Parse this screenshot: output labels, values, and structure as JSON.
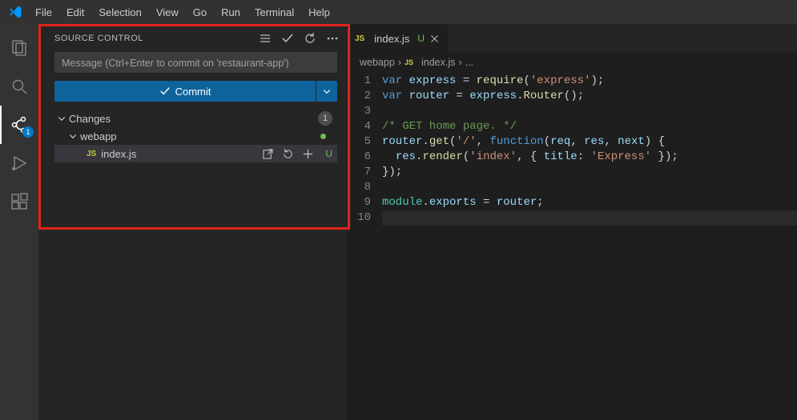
{
  "menu": [
    "File",
    "Edit",
    "Selection",
    "View",
    "Go",
    "Run",
    "Terminal",
    "Help"
  ],
  "activity": {
    "scm_badge": "1"
  },
  "sidebar": {
    "title": "SOURCE CONTROL",
    "commit_placeholder": "Message (Ctrl+Enter to commit on 'restaurant-app')",
    "commit_label": "Commit",
    "changes_label": "Changes",
    "changes_count": "1",
    "folder_label": "webapp",
    "file_label": "index.js",
    "file_status": "U"
  },
  "tab": {
    "file": "index.js",
    "status": "U"
  },
  "breadcrumb": {
    "folder": "webapp",
    "file": "index.js",
    "tail": "..."
  },
  "code": {
    "lines": [
      "1",
      "2",
      "3",
      "4",
      "5",
      "6",
      "7",
      "8",
      "9",
      "10"
    ]
  },
  "source_tokens": {
    "l1": {
      "kw": "var ",
      "v": "express",
      "eq": " = ",
      "fn": "require",
      "op1": "(",
      "s": "'express'",
      "op2": ");"
    },
    "l2": {
      "kw": "var ",
      "v": "router",
      "eq": " = ",
      "obj": "express",
      "dot": ".",
      "fn": "Router",
      "op": "();"
    },
    "l4": {
      "cmt": "/* GET home page. */"
    },
    "l5": {
      "v": "router",
      "dot": ".",
      "fn": "get",
      "op1": "(",
      "s": "'/'",
      "com": ", ",
      "kw": "function",
      "op2": "(",
      "a1": "req",
      "c1": ", ",
      "a2": "res",
      "c2": ", ",
      "a3": "next",
      "op3": ") {"
    },
    "l6": {
      "indent": "  ",
      "v": "res",
      "dot": ".",
      "fn": "render",
      "op1": "(",
      "s1": "'index'",
      "com": ", { ",
      "key": "title",
      "col": ": ",
      "s2": "'Express'",
      "op2": " });"
    },
    "l7": {
      "txt": "});"
    },
    "l9": {
      "obj": "module",
      "dot": ".",
      "v": "exports",
      "eq": " = ",
      "v2": "router",
      "sc": ";"
    }
  }
}
